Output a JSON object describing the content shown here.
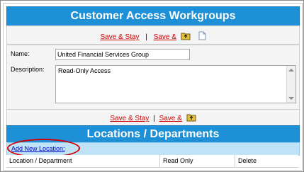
{
  "header": {
    "title": "Customer Access Workgroups"
  },
  "top_actions": {
    "save_stay": "Save & Stay",
    "separator": "|",
    "save_and": "Save &",
    "folder_icon": "folder-up-icon",
    "doc_icon": "new-document-icon"
  },
  "form": {
    "name_label": "Name:",
    "name_value": "United Financial Services Group",
    "description_label": "Description:",
    "description_value": "Read-Only Access"
  },
  "bottom_actions": {
    "save_stay": "Save & Stay",
    "separator": "|",
    "save_and": "Save &",
    "folder_icon": "folder-up-icon"
  },
  "locations": {
    "title": "Locations / Departments",
    "add_link": "Add New Location:",
    "columns": [
      "Location / Department",
      "Read Only",
      "Delete"
    ]
  },
  "colors": {
    "header_blue": "#1e90d8",
    "link_red": "#cc0000",
    "link_blue": "#0000cc",
    "highlight_oval": "#d40000",
    "add_row_bg": "#bfe2f6"
  }
}
